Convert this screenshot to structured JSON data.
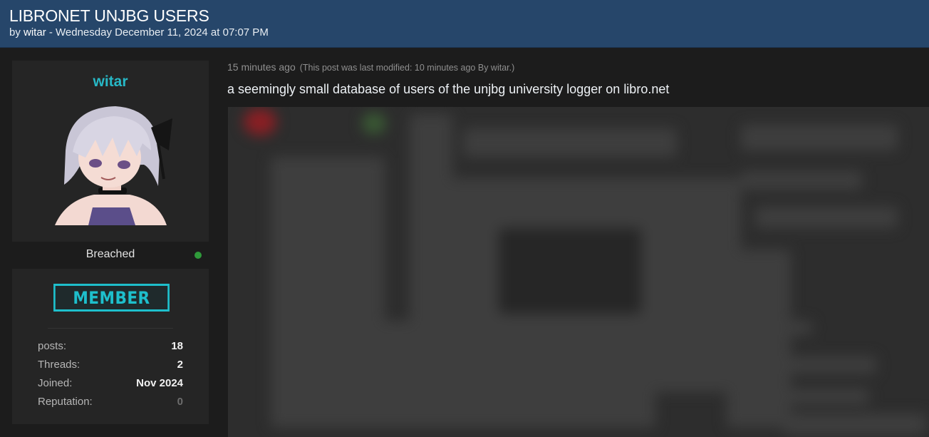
{
  "thread": {
    "title": "LIBRONET UNJBG USERS",
    "byline_prefix": "by ",
    "author": "witar",
    "byline_suffix": " - Wednesday December 11, 2024 at 07:07 PM"
  },
  "user": {
    "username": "witar",
    "avatar": "anime-avatar-image",
    "status": "Breached",
    "online_color": "#2f9a3a",
    "rank": "MEMBER",
    "stats": [
      {
        "label": "posts:",
        "value": "18"
      },
      {
        "label": "Threads:",
        "value": "2"
      },
      {
        "label": "Joined:",
        "value": "Nov 2024"
      },
      {
        "label": "Reputation:",
        "value": "0"
      }
    ]
  },
  "post": {
    "time": "15 minutes ago",
    "edit_note": "(This post was last modified: 10 minutes ago By witar.)",
    "body": "a seemingly small database of users of the unjbg university logger on libro.net",
    "attachment": "blurred-screenshot"
  },
  "colors": {
    "header": "#26466a",
    "accent": "#27b8c6",
    "background": "#1c1c1c"
  }
}
